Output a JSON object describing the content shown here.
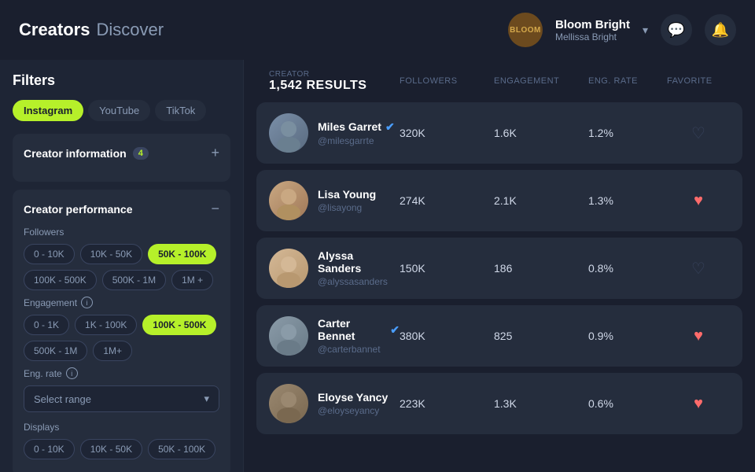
{
  "header": {
    "title": "Creators",
    "subtitle": "Discover",
    "brand": {
      "logo_text": "BLOOM",
      "name": "Bloom Bright",
      "sub": "Mellissa Bright"
    },
    "icons": {
      "message": "💬",
      "bell": "🔔",
      "chevron": "▾"
    }
  },
  "sidebar": {
    "filters_label": "Filters",
    "platforms": [
      {
        "label": "Instagram",
        "active": true
      },
      {
        "label": "YouTube",
        "active": false
      },
      {
        "label": "TikTok",
        "active": false
      }
    ],
    "creator_information": {
      "title": "Creator information",
      "badge": "4",
      "icon_add": "+"
    },
    "creator_performance": {
      "title": "Creator performance",
      "icon_minus": "−",
      "followers_label": "Followers",
      "follower_tags": [
        {
          "label": "0 - 10K",
          "selected": false
        },
        {
          "label": "10K - 50K",
          "selected": false
        },
        {
          "label": "50K - 100K",
          "selected": true
        },
        {
          "label": "100K - 500K",
          "selected": false
        },
        {
          "label": "500K - 1M",
          "selected": false
        },
        {
          "label": "1M +",
          "selected": false
        }
      ],
      "engagement_label": "Engagement",
      "engagement_tags": [
        {
          "label": "0 - 1K",
          "selected": false
        },
        {
          "label": "1K - 100K",
          "selected": false
        },
        {
          "label": "100K - 500K",
          "selected": true
        },
        {
          "label": "500K - 1M",
          "selected": false
        },
        {
          "label": "1M+",
          "selected": false
        }
      ],
      "eng_rate_label": "Eng. rate",
      "dropdown_placeholder": "Select range",
      "displays_label": "Displays",
      "display_tags": [
        {
          "label": "0 - 10K",
          "selected": false
        },
        {
          "label": "10K - 50K",
          "selected": false
        },
        {
          "label": "50K - 100K",
          "selected": false
        }
      ]
    }
  },
  "main": {
    "creator_label": "CREATOR",
    "results_count": "1,542 results",
    "columns": {
      "followers": "FOLLOWERS",
      "engagement": "ENGAGEMENT",
      "eng_rate": "ENG. RATE",
      "favorite": "FAVORITE"
    },
    "creators": [
      {
        "id": 1,
        "name": "Miles Garret",
        "handle": "@milesgarrte",
        "verified": true,
        "followers": "320K",
        "engagement": "1.6K",
        "eng_rate": "1.2%",
        "favorited": false,
        "avatar_class": "avatar-miles",
        "avatar_emoji": "👤"
      },
      {
        "id": 2,
        "name": "Lisa Young",
        "handle": "@lisayong",
        "verified": false,
        "followers": "274K",
        "engagement": "2.1K",
        "eng_rate": "1.3%",
        "favorited": true,
        "avatar_class": "avatar-lisa",
        "avatar_emoji": "👤"
      },
      {
        "id": 3,
        "name": "Alyssa Sanders",
        "handle": "@alyssasanders",
        "verified": false,
        "followers": "150K",
        "engagement": "186",
        "eng_rate": "0.8%",
        "favorited": false,
        "avatar_class": "avatar-alyssa",
        "avatar_emoji": "👤"
      },
      {
        "id": 4,
        "name": "Carter Bennet",
        "handle": "@carterbannet",
        "verified": true,
        "followers": "380K",
        "engagement": "825",
        "eng_rate": "0.9%",
        "favorited": true,
        "avatar_class": "avatar-carter",
        "avatar_emoji": "👤"
      },
      {
        "id": 5,
        "name": "Eloyse Yancy",
        "handle": "@eloyseyancy",
        "verified": false,
        "followers": "223K",
        "engagement": "1.3K",
        "eng_rate": "0.6%",
        "favorited": true,
        "avatar_class": "avatar-eloyse",
        "avatar_emoji": "👤"
      }
    ]
  }
}
